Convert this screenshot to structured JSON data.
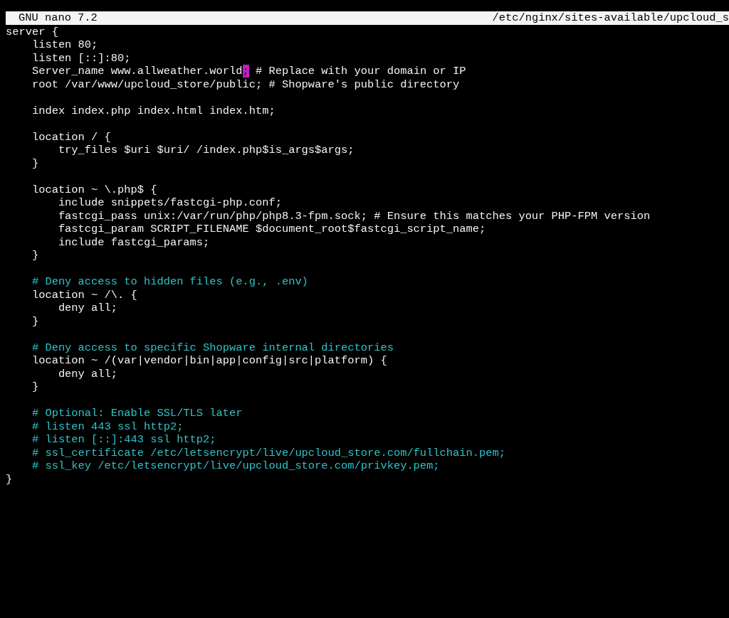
{
  "title_bar": {
    "app": "GNU nano 7.2",
    "file": "/etc/nginx/sites-available/upcloud_s"
  },
  "lines": [
    {
      "kind": "code",
      "text": "server {"
    },
    {
      "kind": "code",
      "text": "    listen 80;"
    },
    {
      "kind": "code",
      "text": "    listen [::]:80;"
    },
    {
      "kind": "cursor",
      "before": "    Server_name www.allweather.world",
      "at": ";",
      "after": " # Replace with your domain or IP"
    },
    {
      "kind": "code",
      "text": "    root /var/www/upcloud_store/public; # Shopware's public directory"
    },
    {
      "kind": "blank"
    },
    {
      "kind": "code",
      "text": "    index index.php index.html index.htm;"
    },
    {
      "kind": "blank"
    },
    {
      "kind": "code",
      "text": "    location / {"
    },
    {
      "kind": "code",
      "text": "        try_files $uri $uri/ /index.php$is_args$args;"
    },
    {
      "kind": "code",
      "text": "    }"
    },
    {
      "kind": "blank"
    },
    {
      "kind": "code",
      "text": "    location ~ \\.php$ {"
    },
    {
      "kind": "code",
      "text": "        include snippets/fastcgi-php.conf;"
    },
    {
      "kind": "code",
      "text": "        fastcgi_pass unix:/var/run/php/php8.3-fpm.sock; # Ensure this matches your PHP-FPM version"
    },
    {
      "kind": "code",
      "text": "        fastcgi_param SCRIPT_FILENAME $document_root$fastcgi_script_name;"
    },
    {
      "kind": "code",
      "text": "        include fastcgi_params;"
    },
    {
      "kind": "code",
      "text": "    }"
    },
    {
      "kind": "blank"
    },
    {
      "kind": "comment",
      "text": "    # Deny access to hidden files (e.g., .env)"
    },
    {
      "kind": "code",
      "text": "    location ~ /\\. {"
    },
    {
      "kind": "code",
      "text": "        deny all;"
    },
    {
      "kind": "code",
      "text": "    }"
    },
    {
      "kind": "blank"
    },
    {
      "kind": "comment",
      "text": "    # Deny access to specific Shopware internal directories"
    },
    {
      "kind": "code",
      "text": "    location ~ /(var|vendor|bin|app|config|src|platform) {"
    },
    {
      "kind": "code",
      "text": "        deny all;"
    },
    {
      "kind": "code",
      "text": "    }"
    },
    {
      "kind": "blank"
    },
    {
      "kind": "comment",
      "text": "    # Optional: Enable SSL/TLS later"
    },
    {
      "kind": "comment",
      "text": "    # listen 443 ssl http2;"
    },
    {
      "kind": "comment",
      "text": "    # listen [::]:443 ssl http2;"
    },
    {
      "kind": "comment",
      "text": "    # ssl_certificate /etc/letsencrypt/live/upcloud_store.com/fullchain.pem;"
    },
    {
      "kind": "comment",
      "text": "    # ssl_key /etc/letsencrypt/live/upcloud_store.com/privkey.pem;"
    },
    {
      "kind": "code",
      "text": "}"
    }
  ]
}
